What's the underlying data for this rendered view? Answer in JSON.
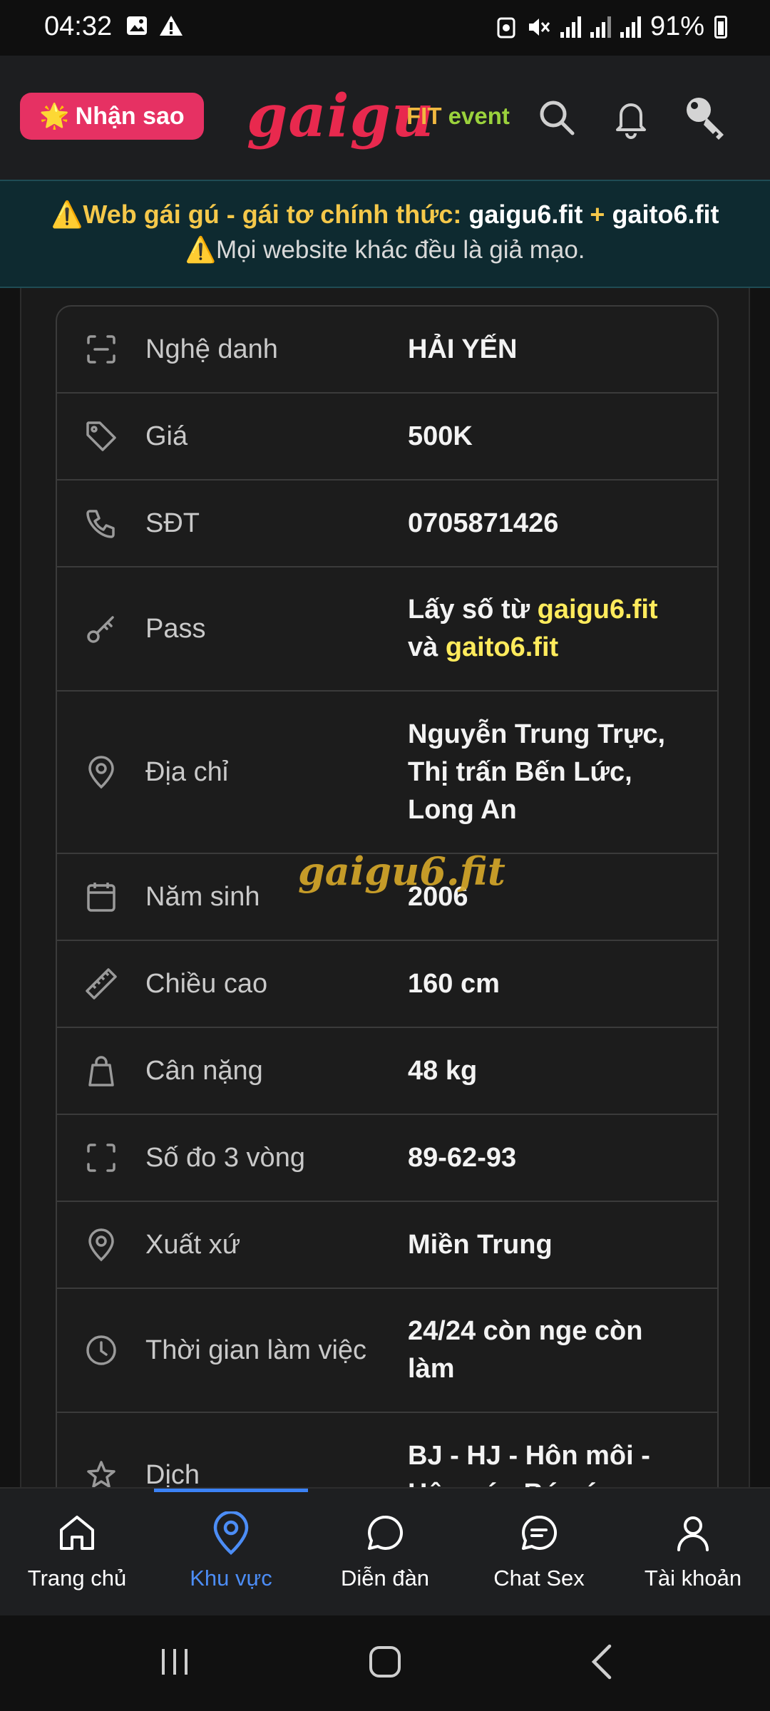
{
  "status_bar": {
    "time": "04:32",
    "battery": "91%"
  },
  "header": {
    "rate_button": "Nhận sao",
    "logo": "gaigu",
    "event_fit": "FIT",
    "event_word": "event"
  },
  "notice": {
    "line1_prefix": "⚠️Web gái gú - gái tơ chính thức:",
    "domain1": "gaigu6.fit",
    "plus": "+",
    "domain2": "gaito6.fit",
    "line2": "⚠️Mọi website khác đều là giả mạo."
  },
  "profile": {
    "rows": [
      {
        "icon": "scan-icon",
        "label": "Nghệ danh",
        "value": "HẢI YẾN"
      },
      {
        "icon": "tag-icon",
        "label": "Giá",
        "value": "500K"
      },
      {
        "icon": "phone-icon",
        "label": "SĐT",
        "value": "0705871426"
      },
      {
        "icon": "key-icon",
        "label": "Pass",
        "value_parts": [
          "Lấy số từ ",
          "gaigu6.fit",
          "và ",
          "gaito6.fit"
        ]
      },
      {
        "icon": "map-pin-icon",
        "label": "Địa chỉ",
        "value_lines": [
          "Nguyễn Trung Trực,",
          "Thị trấn Bến Lức,",
          "Long An"
        ]
      },
      {
        "icon": "calendar-icon",
        "label": "Năm sinh",
        "value": "2006"
      },
      {
        "icon": "ruler-icon",
        "label": "Chiều cao",
        "value": "160 cm"
      },
      {
        "icon": "weight-icon",
        "label": "Cân nặng",
        "value": "48 kg"
      },
      {
        "icon": "measure-icon",
        "label": "Số đo 3 vòng",
        "value": "89-62-93"
      },
      {
        "icon": "map-pin-icon",
        "label": "Xuất xứ",
        "value": "Miền Trung"
      },
      {
        "icon": "clock-icon",
        "label": "Thời gian làm việc",
        "value_lines": [
          "24/24 còn nge còn",
          "làm"
        ]
      },
      {
        "icon": "star-icon",
        "label": "Dịch",
        "value_lines": [
          "BJ - HJ - Hôn môi -",
          "Hôn vú - Bú vú"
        ]
      }
    ]
  },
  "watermark": "gaigu6.fit",
  "bottom_nav": [
    {
      "icon": "home-icon",
      "label": "Trang chủ"
    },
    {
      "icon": "location-icon",
      "label": "Khu vực",
      "active": true
    },
    {
      "icon": "chat-bubble-icon",
      "label": "Diễn đàn"
    },
    {
      "icon": "message-icon",
      "label": "Chat Sex"
    },
    {
      "icon": "user-icon",
      "label": "Tài khoản"
    }
  ],
  "colors": {
    "accent": "#e63163",
    "brand": "#e8294e",
    "active_nav": "#4c8df6",
    "phone": "#4caf50",
    "highlight": "#ffeb5c"
  }
}
